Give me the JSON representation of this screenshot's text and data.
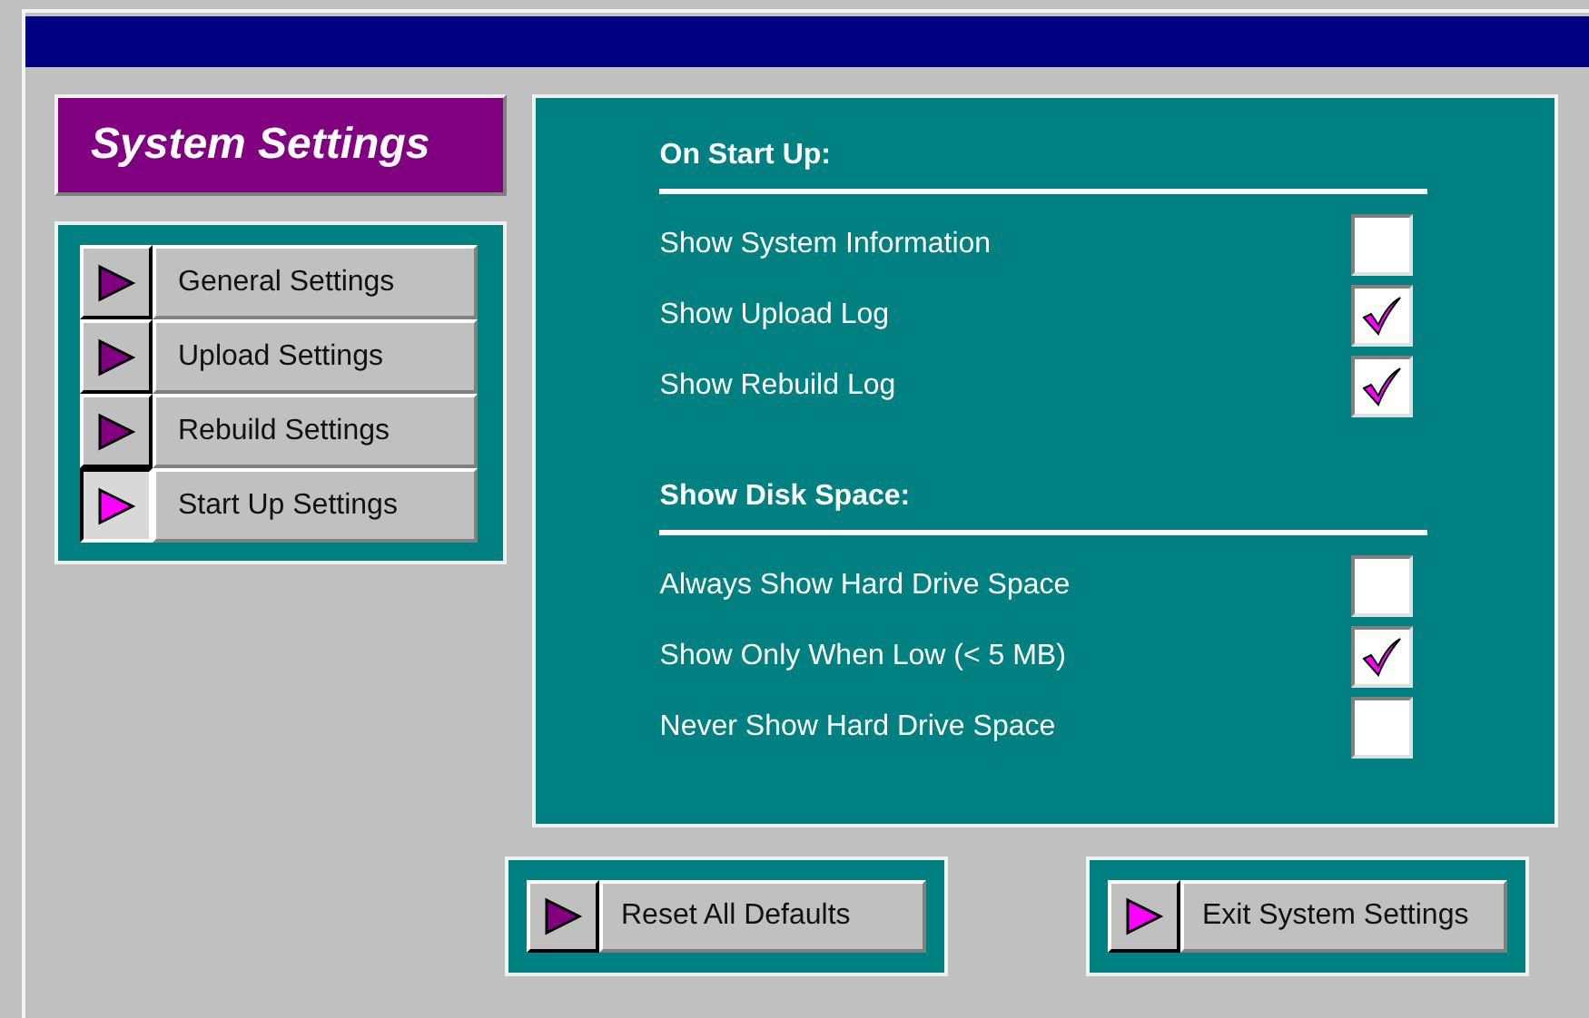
{
  "heading": "System Settings",
  "nav": [
    {
      "label": "General Settings",
      "selected": false
    },
    {
      "label": "Upload Settings",
      "selected": false
    },
    {
      "label": "Rebuild Settings",
      "selected": false
    },
    {
      "label": "Start Up Settings",
      "selected": true
    }
  ],
  "sections": [
    {
      "title": "On Start Up:",
      "options": [
        {
          "label": "Show System Information",
          "checked": false
        },
        {
          "label": "Show Upload Log",
          "checked": true
        },
        {
          "label": "Show Rebuild Log",
          "checked": true
        }
      ]
    },
    {
      "title": "Show Disk Space:",
      "options": [
        {
          "label": "Always Show Hard Drive Space",
          "checked": false
        },
        {
          "label": "Show Only When Low (< 5 MB)",
          "checked": true
        },
        {
          "label": "Never Show Hard Drive Space",
          "checked": false
        }
      ]
    }
  ],
  "buttons": [
    {
      "label": "Reset All Defaults",
      "color": "#800080"
    },
    {
      "label": "Exit System Settings",
      "color": "#ff00ff"
    }
  ]
}
